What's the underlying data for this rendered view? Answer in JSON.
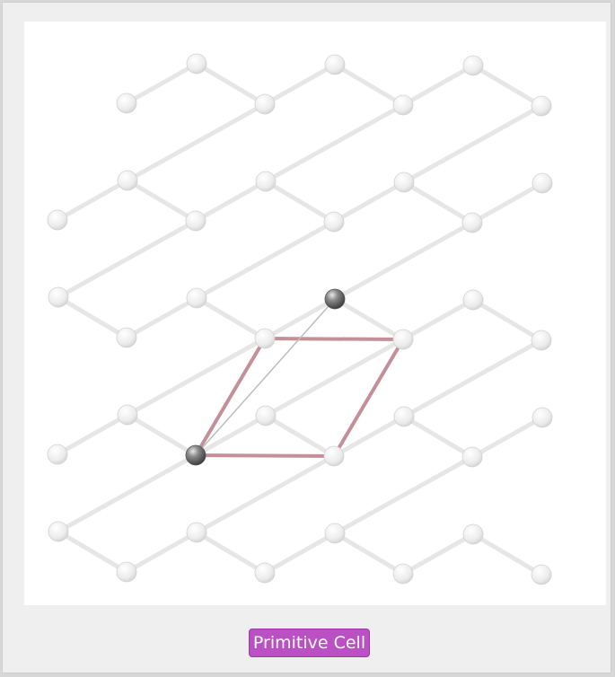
{
  "diagram": {
    "label": "Primitive Cell",
    "colors": {
      "atom": "#ececec",
      "atom_highlight": "#7a7a7a",
      "bond": "#e6e6e6",
      "cell_edge": "#c48f99",
      "badge": "#bb4fc4",
      "background": "#ffffff"
    }
  }
}
